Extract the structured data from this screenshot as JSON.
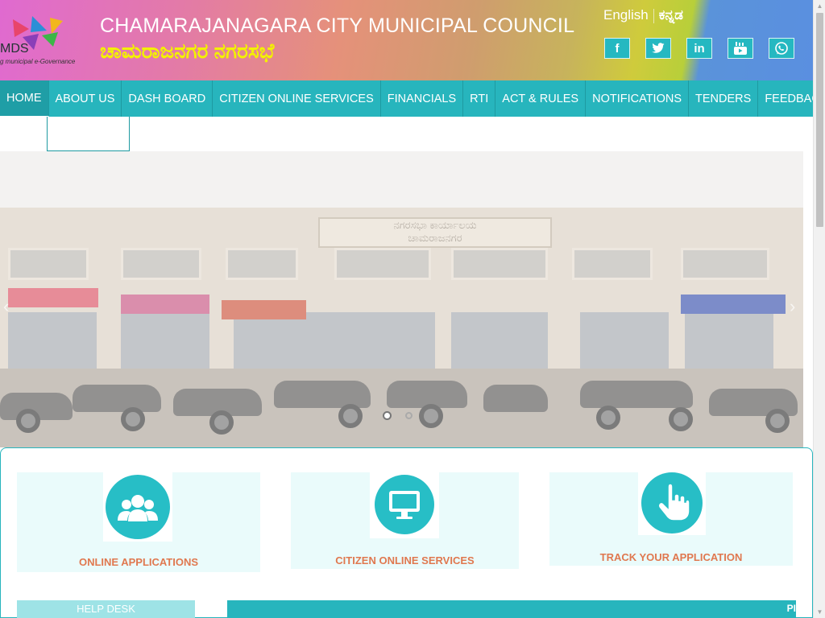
{
  "header": {
    "logo_text": "MDS",
    "logo_tagline": "g municipal e-Governance",
    "title_en": "CHAMARAJANAGARA CITY MUNICIPAL COUNCIL",
    "title_kn": "ಚಾಮರಾಜನಗರ ನಗರಸಭೆ",
    "lang_en": "English",
    "lang_kn": "ಕನ್ನಡ",
    "social": [
      {
        "icon": "facebook-icon",
        "glyph": "f"
      },
      {
        "icon": "twitter-icon",
        "glyph": "🐦"
      },
      {
        "icon": "linkedin-icon",
        "glyph": "in"
      },
      {
        "icon": "youtube-icon",
        "glyph": "▶"
      },
      {
        "icon": "whatsapp-icon",
        "glyph": "✆"
      }
    ]
  },
  "nav": {
    "items": [
      "HOME",
      "ABOUT US",
      "DASH BOARD",
      "CITIZEN ONLINE SERVICES",
      "FINANCIALS",
      "RTI",
      "ACT & RULES",
      "NOTIFICATIONS",
      "TENDERS",
      "FEEDBACK"
    ]
  },
  "banner": {
    "sign_top": "ನಗರಸಭಾ ಕಾರ್ಯಾಲಯ",
    "sign_bottom": "ಚಾಮರಾಜನಗರ",
    "slides": 2,
    "active_slide": 1
  },
  "services": {
    "cards": [
      {
        "label": "ONLINE APPLICATIONS",
        "icon": "users-group-icon"
      },
      {
        "label": "CITIZEN ONLINE SERVICES",
        "icon": "monitor-icon"
      },
      {
        "label": "TRACK YOUR APPLICATION",
        "icon": "pointer-hand-icon"
      }
    ],
    "help_desk": "HELP DESK",
    "ticker_text": "PI"
  },
  "colors": {
    "teal": "#27b5bd",
    "accent_orange": "#e0784f",
    "kannada_title": "#f3f100"
  }
}
